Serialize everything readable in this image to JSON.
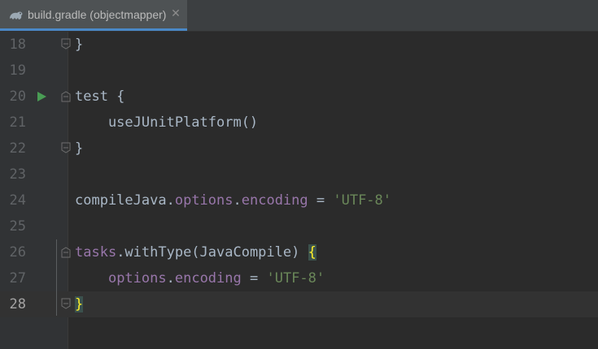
{
  "tab": {
    "title": "build.gradle (objectmapper)",
    "close": "✕",
    "icon": "gradle-icon"
  },
  "colors": {
    "background": "#2b2b2b",
    "gutter": "#313335",
    "text": "#a9b7c6",
    "property": "#9876aa",
    "string": "#6a8759",
    "brace_highlight": "#ffef28",
    "run_icon": "#499c54"
  },
  "lines": [
    {
      "number": "18",
      "code": "}"
    },
    {
      "number": "19",
      "code": ""
    },
    {
      "number": "20",
      "code": "test {"
    },
    {
      "number": "21",
      "code": "    useJUnitPlatform()"
    },
    {
      "number": "22",
      "code": "}"
    },
    {
      "number": "23",
      "code": ""
    },
    {
      "number": "24",
      "code": "compileJava.options.encoding = 'UTF-8'",
      "parts": [
        "compileJava",
        ".",
        "options",
        ".",
        "encoding",
        " = ",
        "'UTF-8'"
      ]
    },
    {
      "number": "25",
      "code": ""
    },
    {
      "number": "26",
      "code": "tasks.withType(JavaCompile) {",
      "parts": [
        "tasks",
        ".withType(JavaCompile) ",
        "{"
      ]
    },
    {
      "number": "27",
      "code": "    options.encoding = 'UTF-8'",
      "parts": [
        "    ",
        "options",
        ".",
        "encoding",
        " = ",
        "'UTF-8'"
      ]
    },
    {
      "number": "28",
      "code": "}"
    }
  ]
}
